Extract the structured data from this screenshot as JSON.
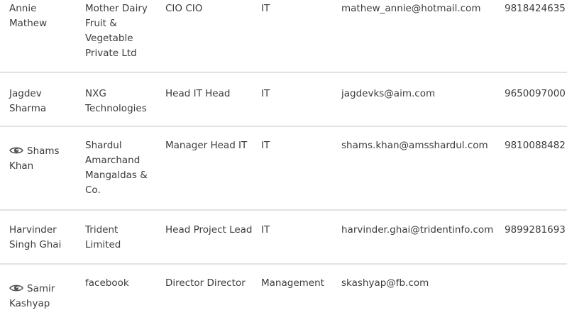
{
  "contacts": [
    {
      "name": "Annie Mathew",
      "company": "Mother Dairy Fruit & Vegetable Private Ltd",
      "designation": "CIO CIO",
      "department": "IT",
      "email": "mathew_annie@hotmail.com",
      "phone": "9818424635",
      "has_view_icon": false
    },
    {
      "name": "Jagdev Sharma",
      "company": "NXG Technologies",
      "designation": "Head IT Head",
      "department": "IT",
      "email": "jagdevks@aim.com",
      "phone": "9650097000",
      "has_view_icon": false
    },
    {
      "name": "Shams Khan",
      "company": "Shardul Amarchand Mangaldas & Co.",
      "designation": "Manager Head IT",
      "department": "IT",
      "email": "shams.khan@amsshardul.com",
      "phone": "9810088482",
      "has_view_icon": true
    },
    {
      "name": "Harvinder Singh Ghai",
      "company": "Trident Limited",
      "designation": "Head Project Lead",
      "department": "IT",
      "email": "harvinder.ghai@tridentinfo.com",
      "phone": "9899281693",
      "has_view_icon": false
    },
    {
      "name": "Samir Kashyap",
      "company": "facebook",
      "designation": "Director Director",
      "department": "Management",
      "email": "skashyap@fb.com",
      "phone": "",
      "has_view_icon": true
    }
  ],
  "icons": {
    "view": "eye-icon"
  },
  "colors": {
    "text": "#3c3c3c",
    "divider": "#e2e2e2",
    "icon": "#555555"
  }
}
